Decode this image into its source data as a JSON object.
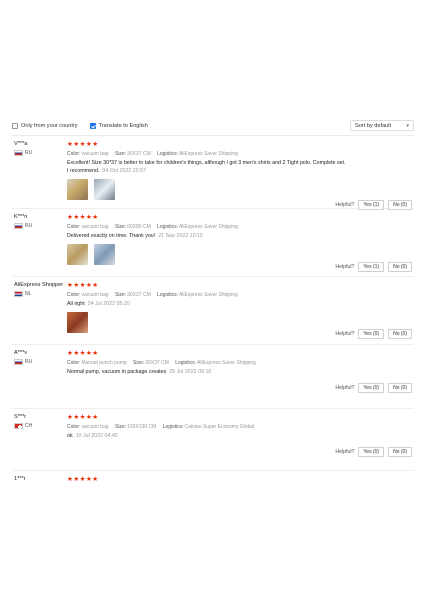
{
  "filters": {
    "only_country": "Only from your country",
    "translate": "Translate to English",
    "sort_value": "Sort by default"
  },
  "labels": {
    "color": "Color:",
    "size": "Size:",
    "logistics": "Logistics:",
    "helpful": "Helpful?"
  },
  "reviews": [
    {
      "user": "V***a",
      "country": "RU",
      "stars": "★★★★★",
      "color": "vacuum bag",
      "size": "30X37 CM",
      "logistics": "AliExpress Saver Shipping",
      "text_line1": "Excellent! Size 30*37 is better to take for children's things, although I got 3 men's shirts and 2 Tight polo. Complete set.",
      "text_line2": "I recommend.",
      "date": "04 Oct 2022 22:57",
      "yes": "Yes (1)",
      "no": "No (0)"
    },
    {
      "user": "K***n",
      "country": "RU",
      "stars": "★★★★★",
      "color": "vacuum bag",
      "size": "60X80 CM",
      "logistics": "AliExpress Saver Shipping",
      "text": "Delivered exactly on time. Thank you!",
      "date": "21 Sep 2022 10:15",
      "yes": "Yes (1)",
      "no": "No (0)"
    },
    {
      "user": "AliExpress Shopper",
      "country": "NL",
      "stars": "★★★★★",
      "color": "vacuum bag",
      "size": "30X37 CM",
      "logistics": "AliExpress Saver Shipping",
      "text": "All right",
      "date": "24 Jul 2022 05:20",
      "yes": "Yes (0)",
      "no": "No (0)"
    },
    {
      "user": "A***v",
      "country": "RU",
      "stars": "★★★★★",
      "color": "Manual punch pump",
      "size": "30X37 CM",
      "logistics": "AliExpress Saver Shipping",
      "text": "Normal pump, vacuum in package creates",
      "date": "25 Jul 2022 09:16",
      "yes": "Yes (0)",
      "no": "No (0)"
    },
    {
      "user": "S***r",
      "country": "CH",
      "stars": "★★★★★",
      "color": "vacuum bag",
      "size": "100X130 CM",
      "logistics": "Cainiao Super Economy Global",
      "text": "ok",
      "date": "10 Jul 2022 04:45",
      "yes": "Yes (0)",
      "no": "No (0)"
    },
    {
      "user": "1***r",
      "stars": "★★★★★"
    }
  ]
}
